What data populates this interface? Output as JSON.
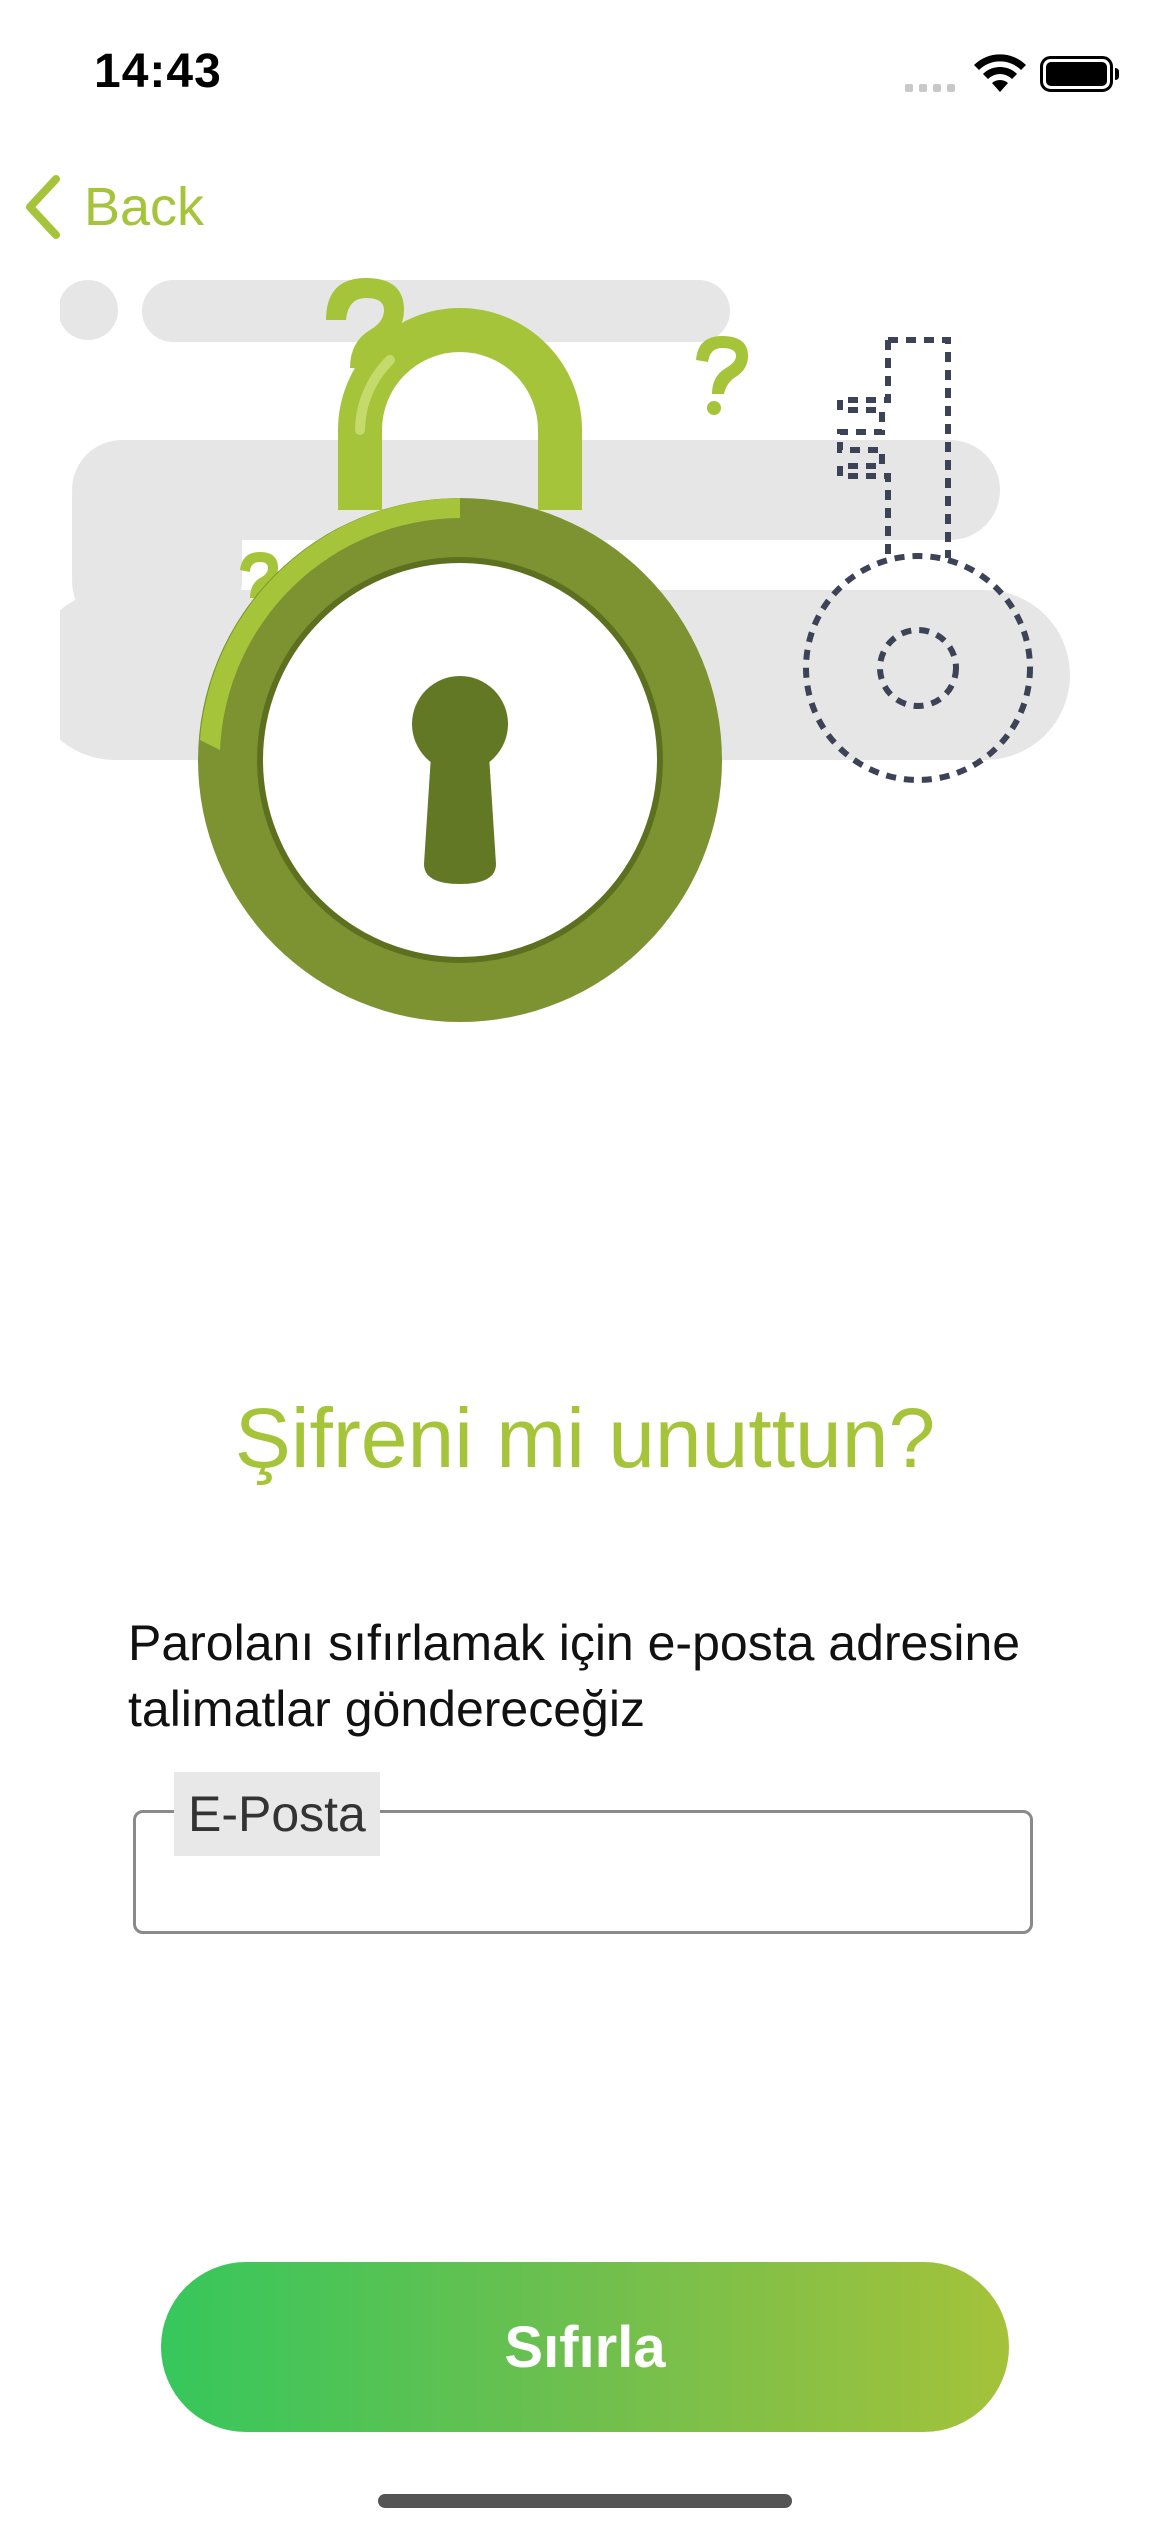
{
  "status_bar": {
    "time": "14:43"
  },
  "nav": {
    "back_label": "Back"
  },
  "main": {
    "title": "Şifreni mi unuttun?",
    "description": "Parolanı sıfırlamak için e-posta adresine talimatlar göndereceğiz",
    "email_field": {
      "label": "E-Posta",
      "value": ""
    },
    "reset_button_label": "Sıfırla"
  },
  "colors": {
    "accent": "#a5c43a",
    "button_gradient_start": "#36c75c",
    "button_gradient_end": "#a4c23a"
  },
  "icons": {
    "illustration": "padlock-with-key-and-question-marks"
  }
}
